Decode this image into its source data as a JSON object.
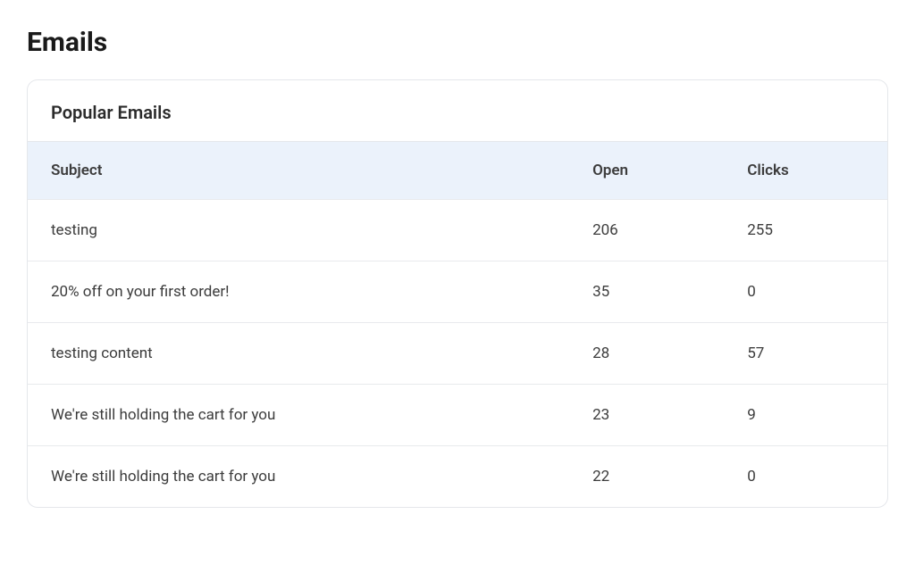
{
  "page": {
    "title": "Emails"
  },
  "card": {
    "header": "Popular Emails"
  },
  "table": {
    "columns": {
      "subject": "Subject",
      "open": "Open",
      "clicks": "Clicks"
    },
    "rows": [
      {
        "subject": "testing",
        "open": "206",
        "clicks": "255"
      },
      {
        "subject": "20% off on your first order!",
        "open": "35",
        "clicks": "0"
      },
      {
        "subject": "testing content",
        "open": "28",
        "clicks": "57"
      },
      {
        "subject": "We're still holding the cart for you",
        "open": "23",
        "clicks": "9"
      },
      {
        "subject": "We're still holding the cart for you",
        "open": "22",
        "clicks": "0"
      }
    ]
  }
}
